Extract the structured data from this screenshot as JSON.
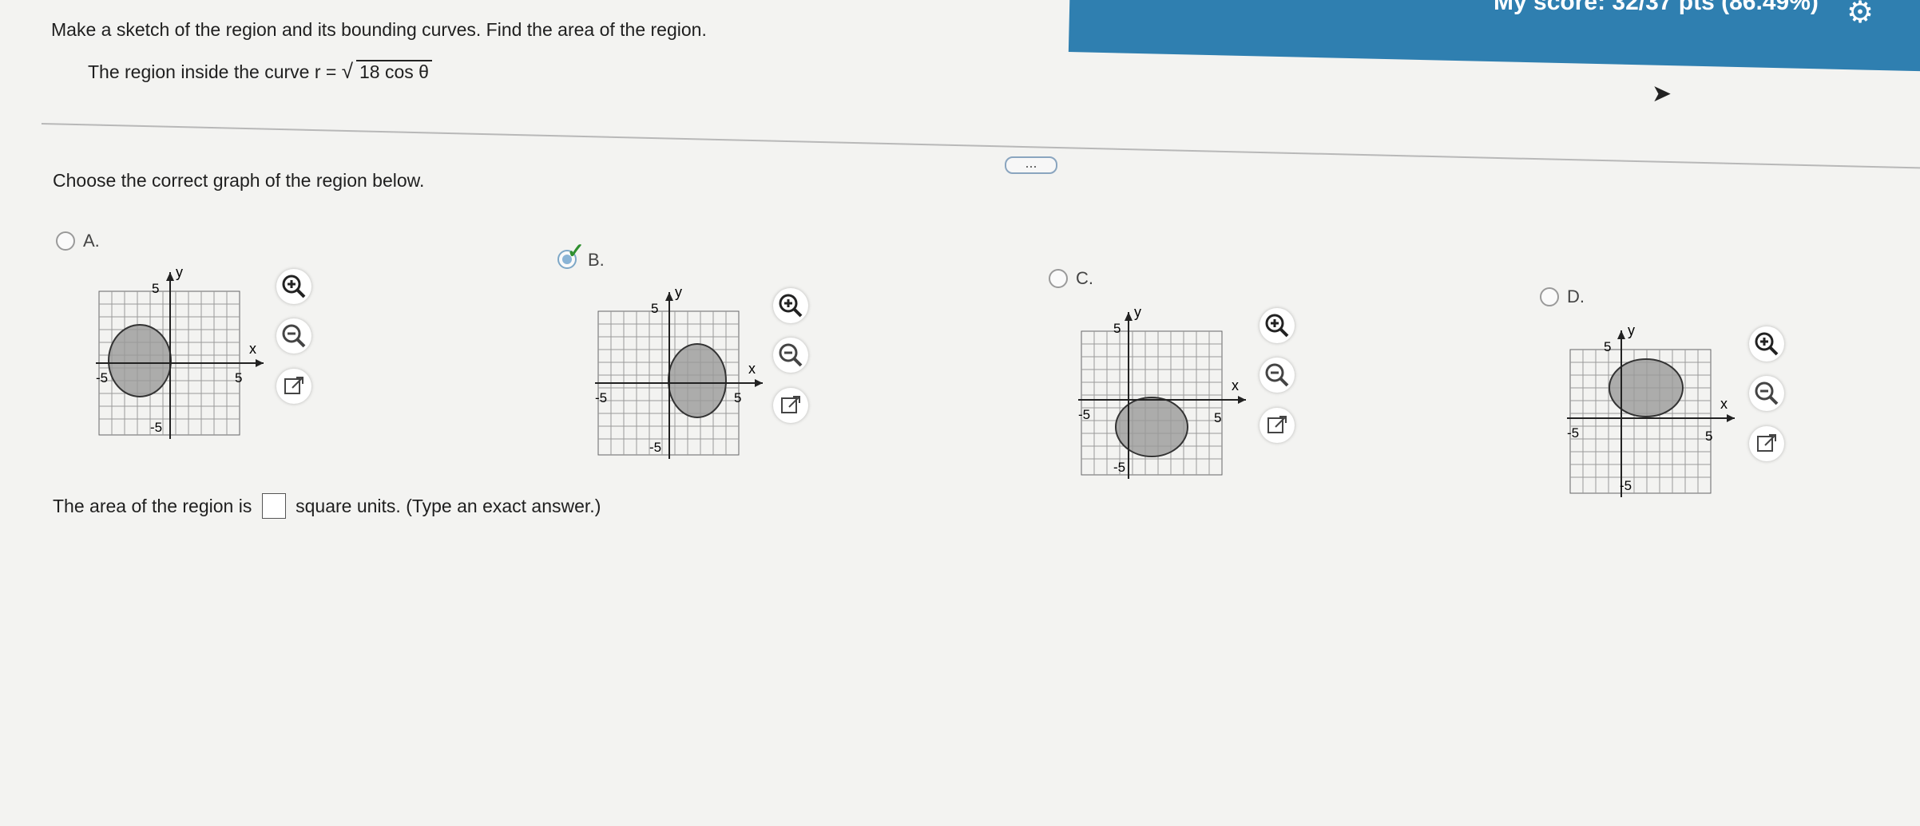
{
  "header": {
    "score_text": "My score: 32/37 pts (86.49%)",
    "settings_icon": "gear-icon"
  },
  "question": {
    "instruction": "Make a sketch of the region and its bounding curves. Find the area of the region.",
    "region_prefix": "The region inside the curve r =",
    "region_radicand": "18 cos θ",
    "prompt": "Choose the correct graph of the region below.",
    "more_label": "...",
    "area_prefix": "The area of the region is",
    "area_suffix": "square units. (Type an exact answer.)",
    "area_value": ""
  },
  "choices": [
    {
      "label": "A.",
      "selected": false
    },
    {
      "label": "B.",
      "selected": true
    },
    {
      "label": "C.",
      "selected": false
    },
    {
      "label": "D.",
      "selected": false
    }
  ],
  "graph": {
    "x_axis_label": "x",
    "y_axis_label": "y",
    "ticks": {
      "top": "5",
      "right": "5",
      "left": "-5",
      "bottom": "-5"
    }
  },
  "tools": {
    "zoom_in_icon": "zoom-in-icon",
    "zoom_out_icon": "zoom-out-icon",
    "popout_icon": "popout-icon"
  }
}
